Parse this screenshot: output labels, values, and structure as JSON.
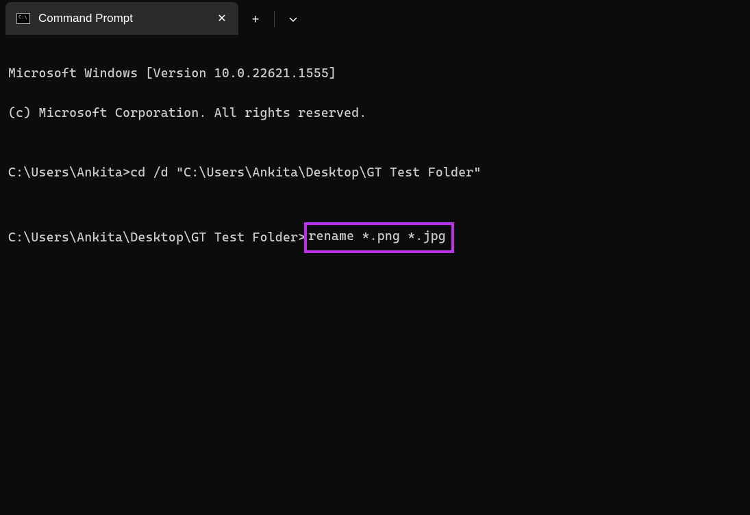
{
  "tab": {
    "title": "Command Prompt"
  },
  "terminal": {
    "line1": "Microsoft Windows [Version 10.0.22621.1555]",
    "line2": "(c) Microsoft Corporation. All rights reserved.",
    "blank1": "",
    "prompt1": "C:\\Users\\Ankita>",
    "cmd1": "cd /d \"C:\\Users\\Ankita\\Desktop\\GT Test Folder\"",
    "blank2": "",
    "prompt2": "C:\\Users\\Ankita\\Desktop\\GT Test Folder>",
    "cmd2": "rename *.png *.jpg"
  }
}
